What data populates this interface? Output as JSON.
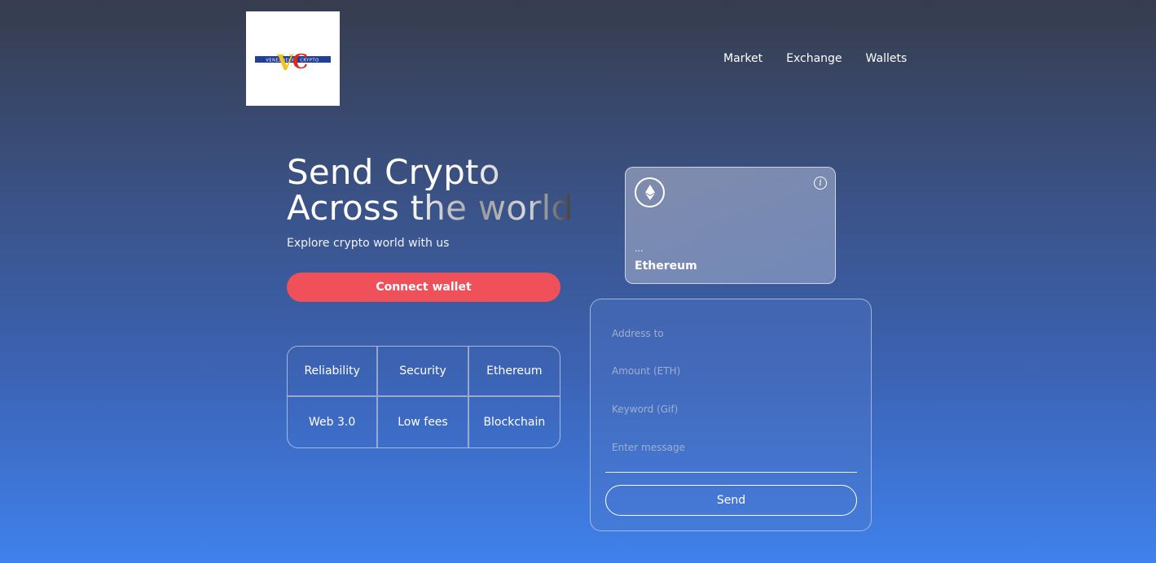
{
  "logo": {
    "brand_text": "VENEZUELAN CRYPTO",
    "letters": "VC"
  },
  "nav": [
    {
      "label": "Market"
    },
    {
      "label": "Exchange"
    },
    {
      "label": "Wallets"
    }
  ],
  "hero": {
    "title_line1": "Send Crypto",
    "title_line2": "Across the world",
    "subtitle": "Explore crypto world with us",
    "connect_label": "Connect wallet"
  },
  "features": [
    "Reliability",
    "Security",
    "Ethereum",
    "Web 3.0",
    "Low fees",
    "Blockchain"
  ],
  "card": {
    "address": "...",
    "network": "Ethereum",
    "icons": [
      "ethereum-icon",
      "info-icon"
    ]
  },
  "form": {
    "address_placeholder": "Address to",
    "amount_placeholder": "Amount (ETH)",
    "keyword_placeholder": "Keyword (Gif)",
    "message_placeholder": "Enter message",
    "send_label": "Send"
  },
  "colors": {
    "accent": "#f0505a",
    "gradient_top": "#363c4d",
    "gradient_bottom": "#3f82ec"
  }
}
